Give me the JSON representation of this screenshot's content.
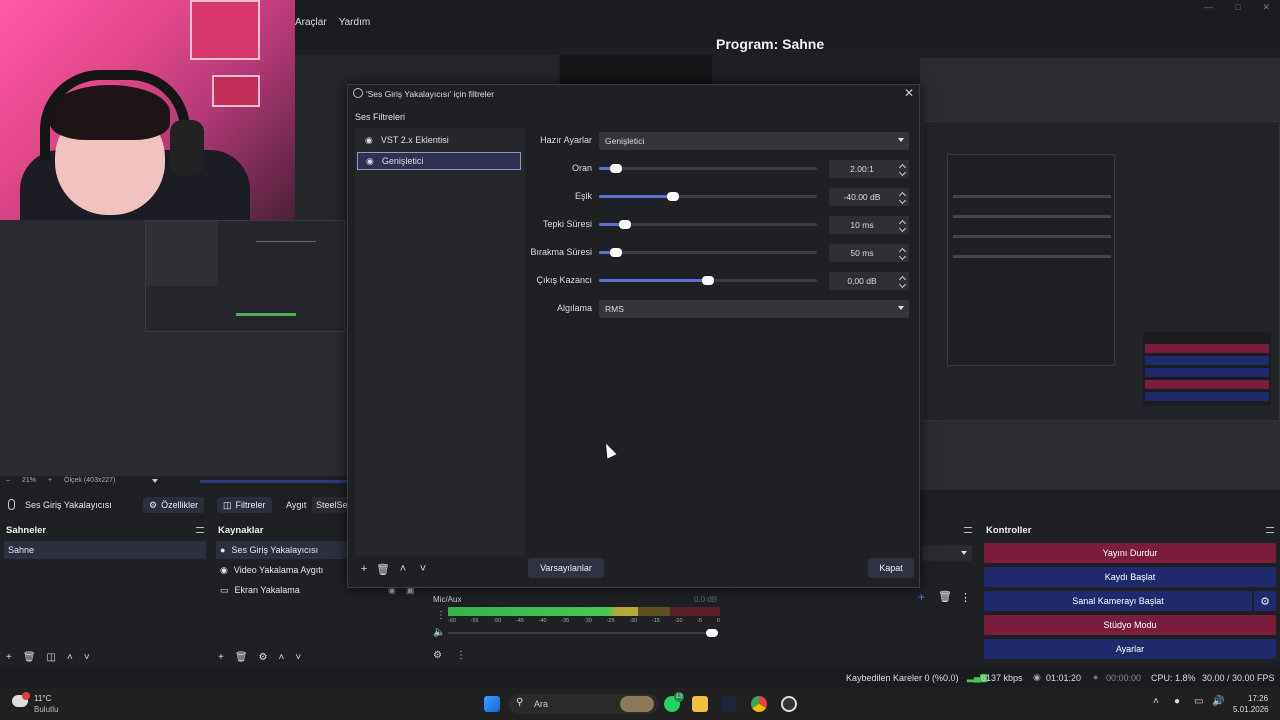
{
  "menu": {
    "items": [
      "Araçlar",
      "Yardım"
    ]
  },
  "program": {
    "title": "Program: Sahne"
  },
  "preview": {
    "zoom": "21%",
    "scale_label": "Ölçek (403x227)"
  },
  "source_bar": {
    "current_source": "Ses Giriş Yakalayıcısı",
    "properties_label": "Özellikler",
    "filters_label": "Filtreler",
    "device_label": "Aygıt",
    "device_value": "SteelSe"
  },
  "dialog": {
    "title": "'Ses Giriş Yakalayıcısı' için filtreler",
    "audio_filters_label": "Ses Filtreleri",
    "filters": [
      {
        "label": "VST 2.x Eklentisi",
        "selected": false
      },
      {
        "label": "Genişletici",
        "selected": true
      }
    ],
    "preset": {
      "label": "Hazır Ayarlar",
      "value": "Genişletici"
    },
    "sliders": [
      {
        "label": "Oran",
        "value": "2.00:1",
        "level": 0.08
      },
      {
        "label": "Eşik",
        "value": "-40.00 dB",
        "level": 0.34
      },
      {
        "label": "Tepki Süresi",
        "value": "10 ms",
        "level": 0.12
      },
      {
        "label": "Bırakma Süresi",
        "value": "50 ms",
        "level": 0.08
      },
      {
        "label": "Çıkış Kazancı",
        "value": "0,00 dB",
        "level": 0.5
      }
    ],
    "detection": {
      "label": "Algılama",
      "value": "RMS"
    },
    "defaults_button": "Varsayılanlar",
    "close_button": "Kapat"
  },
  "docks": {
    "scenes": {
      "title": "Sahneler",
      "items": [
        "Sahne"
      ]
    },
    "sources": {
      "title": "Kaynaklar",
      "items": [
        {
          "label": "Ses Giriş Yakalayıcısı",
          "icon": "microphone-icon"
        },
        {
          "label": "Video Yakalama Aygıtı",
          "icon": "camera-icon"
        },
        {
          "label": "Ekran Yakalama",
          "icon": "monitor-icon"
        }
      ]
    },
    "mixer": {
      "channel": "Mic/Aux",
      "db": "0.0 dB",
      "ticks": [
        "-60",
        "-55",
        "-50",
        "-45",
        "-40",
        "-35",
        "-30",
        "-25",
        "-20",
        "-15",
        "-10",
        "-5",
        "0"
      ]
    },
    "controls": {
      "title": "Kontroller",
      "buttons": [
        {
          "label": "Yayını Durdur",
          "color": "#7a1c3c"
        },
        {
          "label": "Kaydı Başlat",
          "color": "#1f2a6e"
        },
        {
          "label": "Sanal Kamerayı Başlat",
          "color": "#1f2a6e"
        },
        {
          "label": "Stüdyo Modu",
          "color": "#7a1c3c"
        },
        {
          "label": "Ayarlar",
          "color": "#1f2a6e"
        }
      ]
    }
  },
  "status": {
    "dropped": "Kaybedilen Kareler 0 (%0.0)",
    "bitrate": "6137 kbps",
    "live_time": "01:01:20",
    "rec_time": "00:00:00",
    "cpu": "CPU: 1.8%",
    "fps": "30.00 / 30.00 FPS"
  },
  "taskbar": {
    "weather_temp": "11°C",
    "weather_desc": "Bulutlu",
    "search_placeholder": "Ara",
    "time": "17:26",
    "date": "5.01.2026",
    "whatsapp_badge": "13"
  }
}
